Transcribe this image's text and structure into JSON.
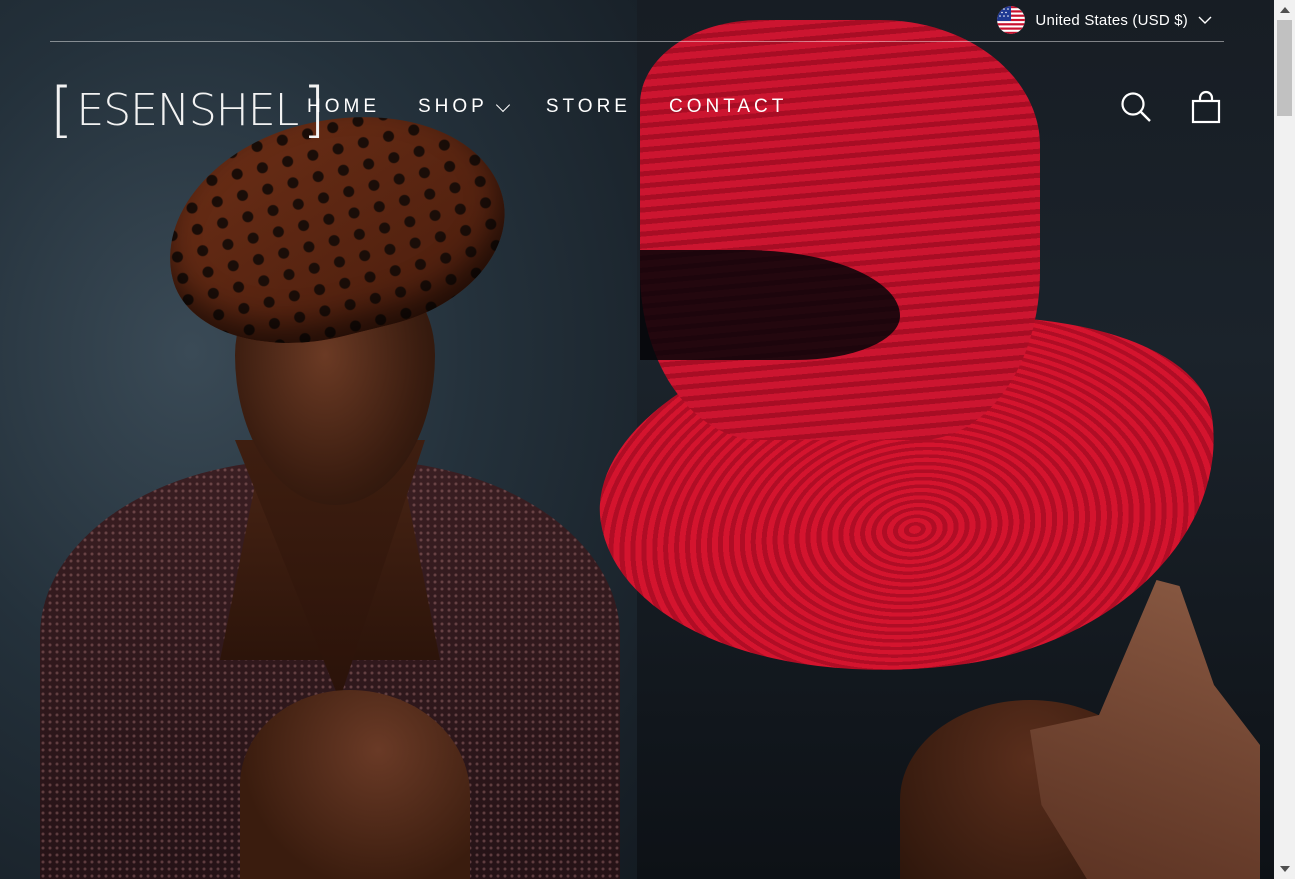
{
  "header": {
    "currency_label": "United States (USD $)",
    "logo_text": "ESENSHEL",
    "nav": [
      {
        "label": "HOME"
      },
      {
        "label": "SHOP"
      },
      {
        "label": "STORE"
      },
      {
        "label": "CONTACT"
      }
    ],
    "icons": {
      "flag": "us-flag-icon",
      "currency_dropdown": "chevron-down-icon",
      "search": "search-icon",
      "cart": "cart-bag-icon"
    }
  },
  "hero": {
    "left_image": "woman-in-leopard-print-hat-and-sparkle-coat",
    "right_image": "red-straw-hat-with-hand"
  },
  "colors": {
    "header_text": "#ffffff",
    "hat_red": "#cc1530",
    "background_dark": "#1c2630"
  }
}
